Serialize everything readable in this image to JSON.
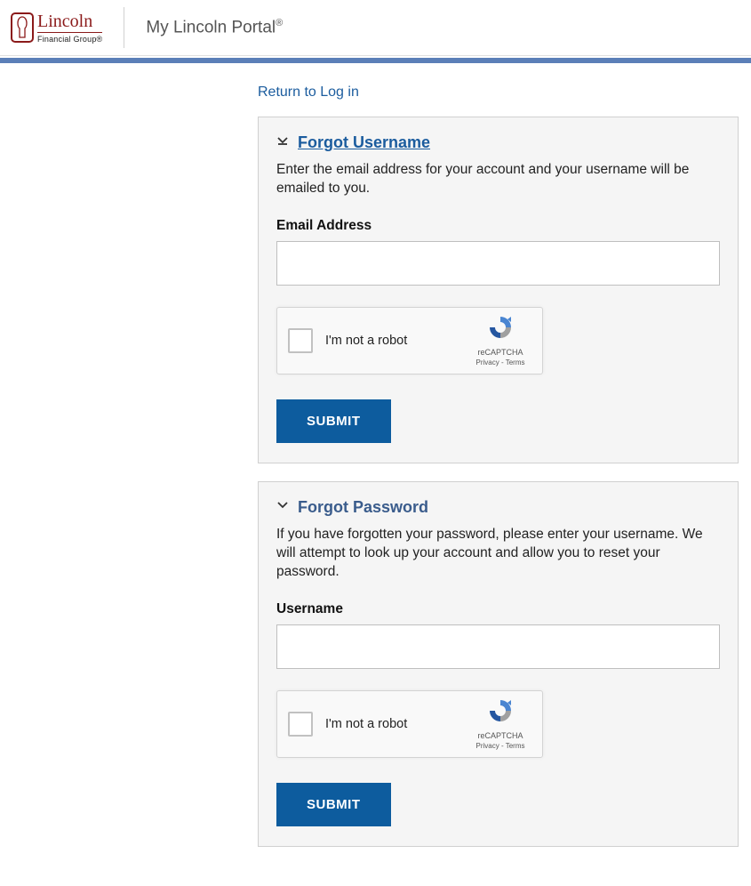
{
  "header": {
    "logo_line1": "Lincoln",
    "logo_line2": "Financial Group®",
    "portal_title": "My Lincoln Portal",
    "portal_reg": "®"
  },
  "return_link": "Return to Log in",
  "forgot_username": {
    "title": "Forgot Username",
    "description": "Enter the email address for your account and your username will be emailed to you.",
    "field_label": "Email Address",
    "submit": "SUBMIT"
  },
  "forgot_password": {
    "title": "Forgot Password",
    "description": "If you have forgotten your password, please enter your username. We will attempt to look up your account and allow you to reset your password.",
    "field_label": "Username",
    "submit": "SUBMIT"
  },
  "recaptcha": {
    "label": "I'm not a robot",
    "brand": "reCAPTCHA",
    "links": "Privacy - Terms"
  }
}
